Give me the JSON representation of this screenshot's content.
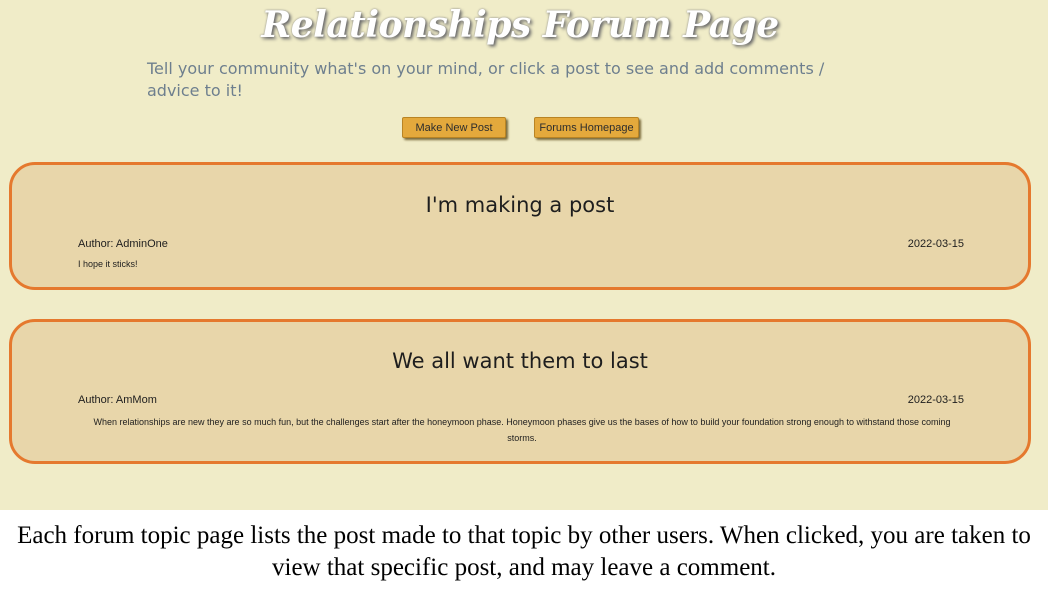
{
  "header": {
    "title": "Relationships Forum Page",
    "subtitle": "Tell your community what's on your mind, or click a post to see and add comments / advice to it!"
  },
  "buttons": {
    "new_post": "Make New Post",
    "homepage": "Forums Homepage"
  },
  "posts": [
    {
      "title": "I'm making a post",
      "author": "Author: AdminOne",
      "date": "2022-03-15",
      "body": "I hope it sticks!"
    },
    {
      "title": "We all want them to last",
      "author": "Author: AmMom",
      "date": "2022-03-15",
      "body": "When relationships are new they are so much fun, but the challenges start after the honeymoon phase. Honeymoon phases give us the bases of how to build your foundation strong enough to withstand those coming storms."
    }
  ],
  "caption": "Each forum topic page lists the post made to that topic by other users. When clicked, you are taken to view that specific post, and may leave a comment.",
  "colors": {
    "background": "#f0ecc8",
    "post_fill": "#e8d6aa",
    "post_border": "#e5792e",
    "button": "#e4a93c"
  }
}
